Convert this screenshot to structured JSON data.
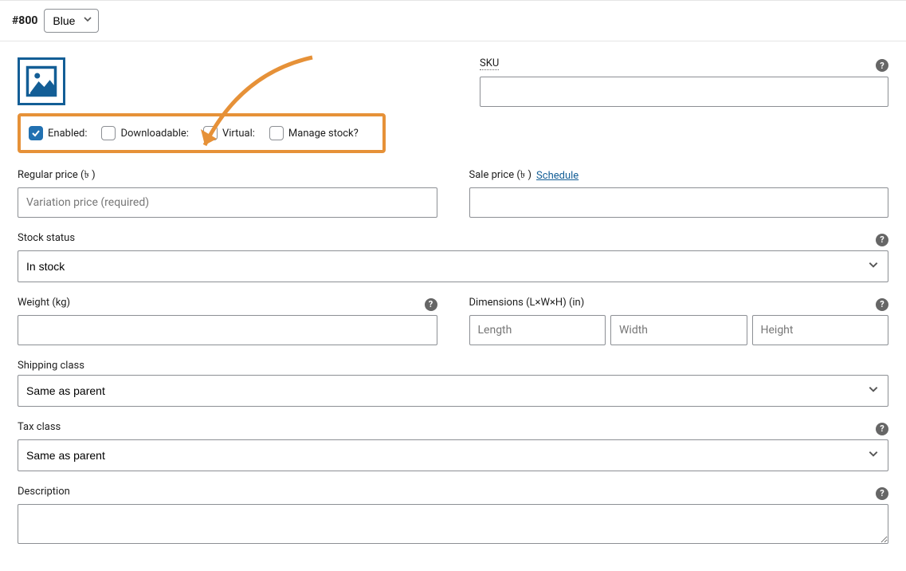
{
  "header": {
    "variation_id": "#800",
    "attribute_value": "Blue"
  },
  "checkboxes": {
    "enabled": {
      "label": "Enabled:",
      "checked": true
    },
    "downloadable": {
      "label": "Downloadable:",
      "checked": false
    },
    "virtual": {
      "label": "Virtual:",
      "checked": false
    },
    "manage_stock": {
      "label": "Manage stock?",
      "checked": false
    }
  },
  "fields": {
    "sku": {
      "label": "SKU",
      "value": ""
    },
    "regular_price": {
      "label": "Regular price (৳ )",
      "placeholder": "Variation price (required)",
      "value": ""
    },
    "sale_price": {
      "label": "Sale price (৳ )",
      "schedule_label": "Schedule",
      "value": ""
    },
    "stock_status": {
      "label": "Stock status",
      "value": "In stock"
    },
    "weight": {
      "label": "Weight (kg)",
      "value": ""
    },
    "dimensions": {
      "label": "Dimensions (L×W×H) (in)",
      "length_placeholder": "Length",
      "width_placeholder": "Width",
      "height_placeholder": "Height",
      "length": "",
      "width": "",
      "height": ""
    },
    "shipping_class": {
      "label": "Shipping class",
      "value": "Same as parent"
    },
    "tax_class": {
      "label": "Tax class",
      "value": "Same as parent"
    },
    "description": {
      "label": "Description",
      "value": ""
    }
  }
}
